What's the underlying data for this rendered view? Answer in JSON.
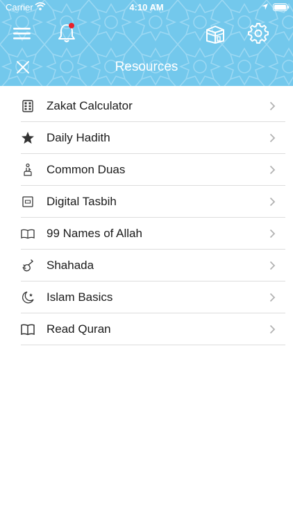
{
  "status_bar": {
    "carrier": "Carrier",
    "time": "4:10 AM"
  },
  "header": {
    "title": "Resources",
    "colors": {
      "background": "#73c8ec",
      "notification_dot": "#e8202a"
    }
  },
  "resources": [
    {
      "label": "Zakat Calculator",
      "icon": "calculator-icon"
    },
    {
      "label": "Daily Hadith",
      "icon": "star-icon"
    },
    {
      "label": "Common Duas",
      "icon": "praying-hands-icon"
    },
    {
      "label": "Digital Tasbih",
      "icon": "counter-icon"
    },
    {
      "label": "99 Names of Allah",
      "icon": "open-book-icon"
    },
    {
      "label": "Shahada",
      "icon": "index-finger-icon"
    },
    {
      "label": "Islam Basics",
      "icon": "crescent-star-icon"
    },
    {
      "label": "Read Quran",
      "icon": "quran-book-icon"
    }
  ]
}
